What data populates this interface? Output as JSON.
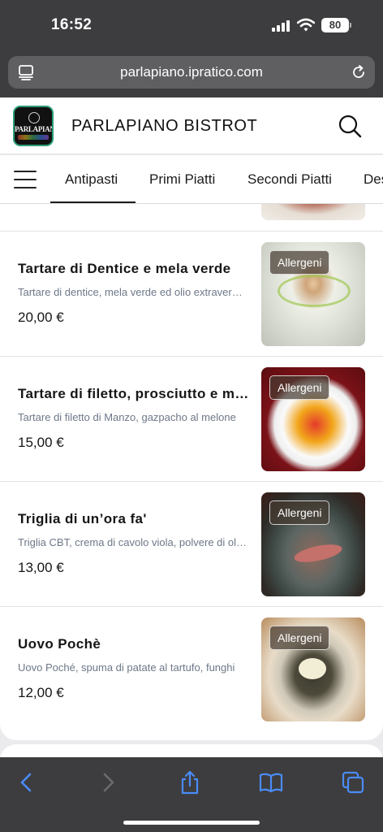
{
  "status_bar": {
    "time": "16:52",
    "battery": "80"
  },
  "browser": {
    "url": "parlapiano.ipratico.com"
  },
  "site": {
    "title": "PARLAPIANO BISTROT",
    "logo_text": "PARLAPIANO"
  },
  "categories": [
    "Antipasti",
    "Primi Piatti",
    "Secondi Piatti",
    "Des"
  ],
  "active_category": "Antipasti",
  "items": [
    {
      "name": "Tartare di Dentice e mela verde",
      "description": "Tartare di dentice, mela verde ed olio extravergine",
      "price": "20,00 €",
      "badge": "Allergeni"
    },
    {
      "name": "Tartare di filetto, prosciutto e melone",
      "description": "Tartare di filetto di Manzo, gazpacho al melone",
      "price": "15,00 €",
      "badge": "Allergeni"
    },
    {
      "name": "Triglia di un’ora fa'",
      "description": "Triglia CBT, crema di cavolo viola, polvere di olive",
      "price": "13,00 €",
      "badge": "Allergeni"
    },
    {
      "name": "Uovo Pochè",
      "description": "Uovo Poché, spuma di patate al tartufo, funghi",
      "price": "12,00 €",
      "badge": "Allergeni"
    }
  ],
  "colors": {
    "browser_chrome": "#3d3d3f",
    "toolbar_accent": "#4a8cf7",
    "description_text": "#6e7888"
  }
}
